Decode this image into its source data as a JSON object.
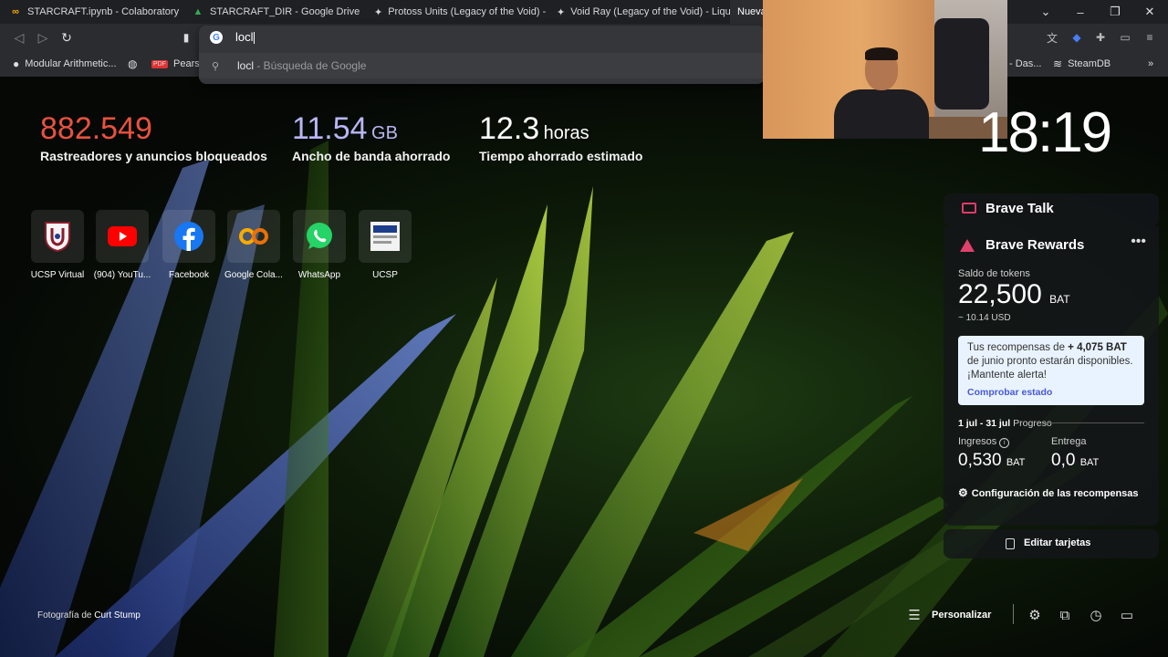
{
  "tabs": [
    {
      "title": "STARCRAFT.ipynb - Colaboratory",
      "icon": "colab-icon"
    },
    {
      "title": "STARCRAFT_DIR - Google Drive",
      "icon": "drive-icon"
    },
    {
      "title": "Protoss Units (Legacy of the Void) - Lic",
      "icon": "liquipedia-icon"
    },
    {
      "title": "Void Ray (Legacy of the Void) - Liquipe",
      "icon": "liquipedia-icon"
    },
    {
      "title": "Nueva",
      "icon": "brave-icon"
    }
  ],
  "omnibox": {
    "input": "locl",
    "suggestion_query": "locl",
    "suggestion_sub": " - Búsqueda de Google"
  },
  "bookmarks": [
    {
      "label": "Modular Arithmetic..."
    },
    {
      "label": "Pearso"
    },
    {
      "label": "- Das..."
    },
    {
      "label": "SteamDB"
    }
  ],
  "stats": [
    {
      "num": "882.549",
      "unit": "",
      "label": "Rastreadores y anuncios bloqueados",
      "color": "#e8523f"
    },
    {
      "num": "11.54",
      "unit": "GB",
      "label": "Ancho de banda ahorrado",
      "color": "#b9b6f5"
    },
    {
      "num": "12.3",
      "unit": "horas",
      "label": "Tiempo ahorrado estimado",
      "color": "#ffffff"
    }
  ],
  "clock": "18:19",
  "tiles": [
    {
      "label": "UCSP Virtual",
      "icon": "ucsp-shield-icon"
    },
    {
      "label": "(904) YouTu...",
      "icon": "youtube-icon"
    },
    {
      "label": "Facebook",
      "icon": "facebook-icon"
    },
    {
      "label": "Google Cola...",
      "icon": "colab-icon"
    },
    {
      "label": "WhatsApp",
      "icon": "whatsapp-icon"
    },
    {
      "label": "UCSP",
      "icon": "portal-academico-icon"
    }
  ],
  "brave_talk": {
    "title": "Brave Talk"
  },
  "rewards": {
    "title": "Brave Rewards",
    "balance_label": "Saldo de tokens",
    "balance": "22,500",
    "currency": "BAT",
    "usd": "~ 10.14 USD",
    "notice_pre": "Tus recompensas de ",
    "notice_amount": "+ 4,075 BAT",
    "notice_post": " de junio pronto estarán disponibles. ¡Mantente alerta!",
    "notice_link": "Comprobar estado",
    "period": "1 jul - 31 jul",
    "progress_label": "Progreso",
    "income_label": "Ingresos",
    "income": "0,530",
    "delivery_label": "Entrega",
    "delivery": "0,0",
    "settings": "Configuración de las recompensas"
  },
  "edit_cards": "Editar tarjetas",
  "photo_credit_prefix": "Fotografía de ",
  "photo_credit_name": "Curt Stump",
  "customize": "Personalizar"
}
